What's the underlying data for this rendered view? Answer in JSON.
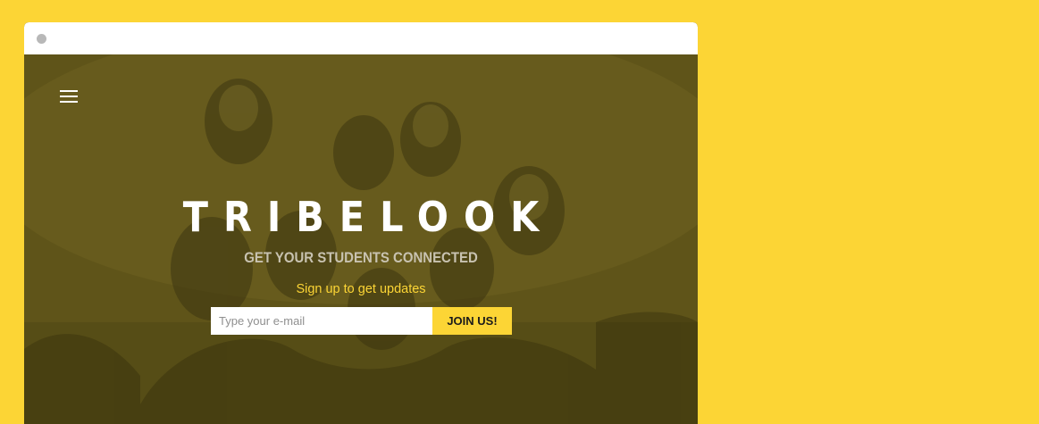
{
  "browser": {
    "chrome_color": "#ffffff",
    "dot_color": "#b8b8b8"
  },
  "page": {
    "background_color": "#FCD535",
    "menu_icon": "hamburger-menu-icon",
    "logo_text": "TRIBELOOK",
    "tagline": "GET YOUR STUDENTS CONNECTED",
    "signup_heading": "Sign up to get updates",
    "email_placeholder": "Type your e-mail",
    "email_value": "",
    "join_button_label": "JOIN US!",
    "accent_color": "#FCD535"
  }
}
